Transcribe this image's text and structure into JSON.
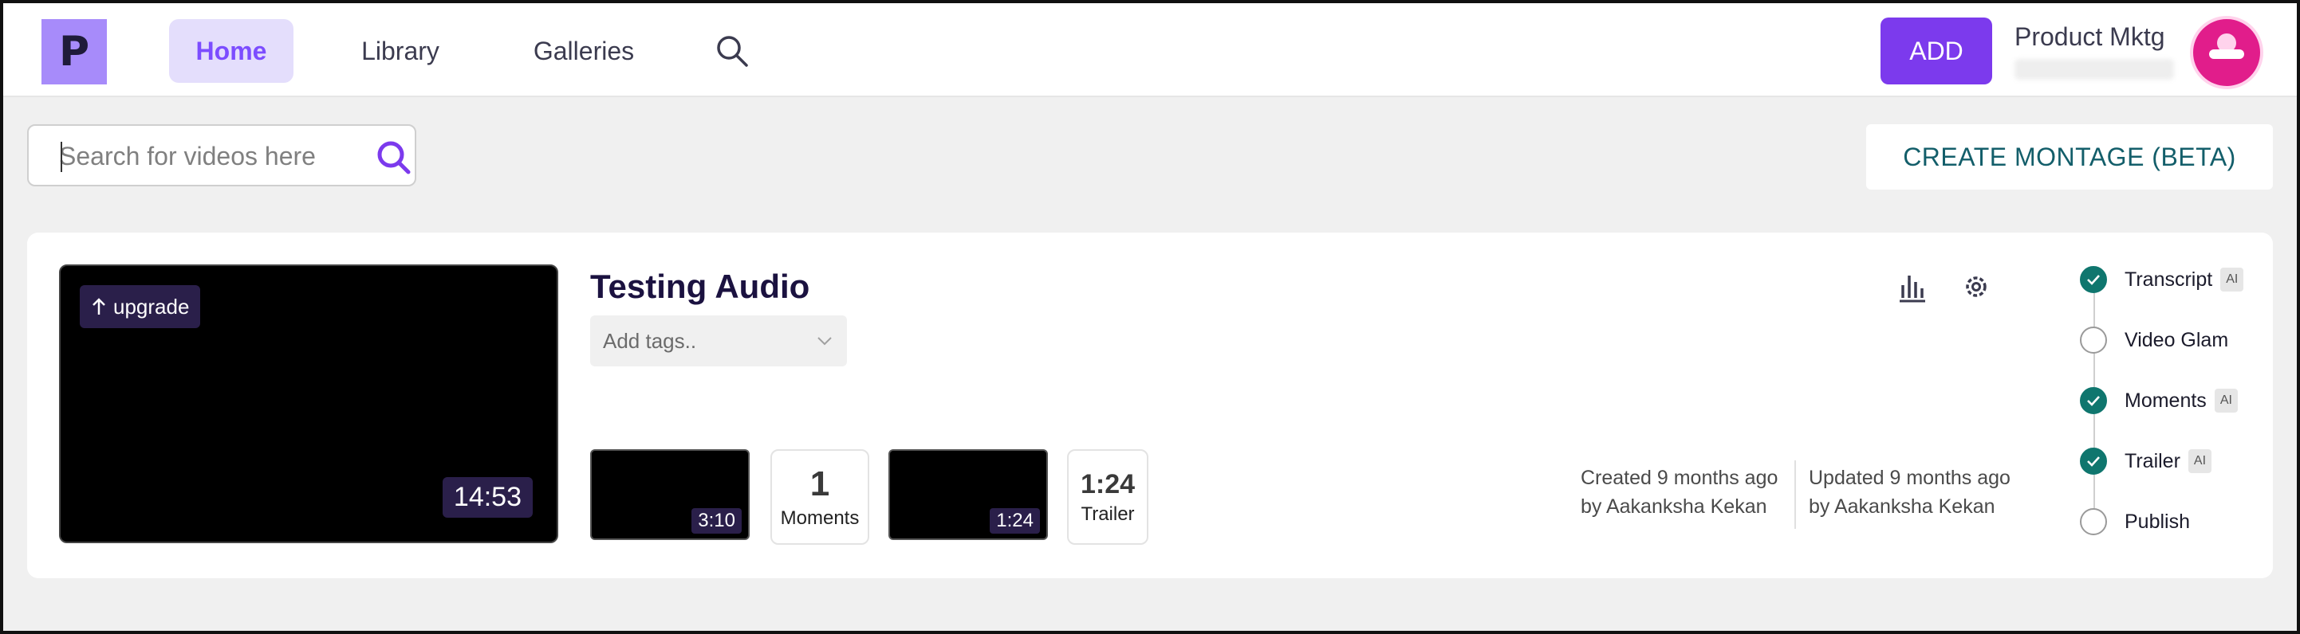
{
  "nav": {
    "logo_letter": "P",
    "tabs": [
      {
        "label": "Home",
        "active": true
      },
      {
        "label": "Library",
        "active": false
      },
      {
        "label": "Galleries",
        "active": false
      }
    ],
    "search_icon": "search-icon",
    "add_label": "ADD",
    "account_name": "Product Mktg",
    "avatar_color": "#e11d8b"
  },
  "search": {
    "placeholder": "Search for videos here",
    "value": ""
  },
  "montage_label": "CREATE MONTAGE (BETA)",
  "video": {
    "title": "Testing Audio",
    "upgrade_label": "upgrade",
    "duration": "14:53",
    "tags_placeholder": "Add tags..",
    "clip_duration": "3:10",
    "moments_count": "1",
    "moments_label": "Moments",
    "trailer_duration": "1:24",
    "trailer_thumb_duration": "1:24",
    "trailer_label": "Trailer",
    "created_line1": "Created 9 months ago",
    "created_line2": "by Aakanksha Kekan",
    "updated_line1": "Updated 9 months ago",
    "updated_line2": "by Aakanksha Kekan"
  },
  "steps": [
    {
      "label": "Transcript",
      "done": true,
      "ai": "AI"
    },
    {
      "label": "Video Glam",
      "done": false,
      "ai": ""
    },
    {
      "label": "Moments",
      "done": true,
      "ai": "AI"
    },
    {
      "label": "Trailer",
      "done": true,
      "ai": "AI"
    },
    {
      "label": "Publish",
      "done": false,
      "ai": ""
    }
  ],
  "colors": {
    "accent": "#7c3aed",
    "active_tab_bg": "#e4defc",
    "step_done": "#0f766e",
    "montage_text": "#135e6a"
  }
}
